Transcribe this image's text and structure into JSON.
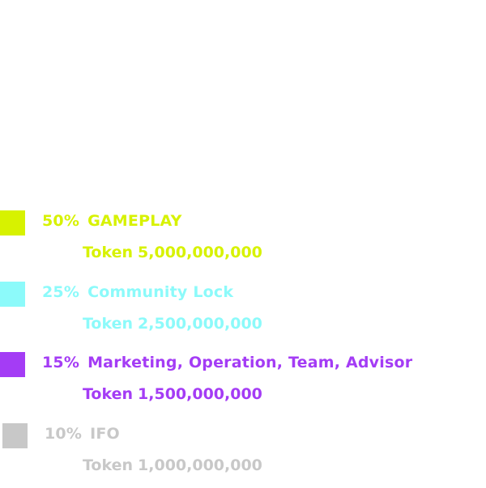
{
  "chart_data": {
    "type": "pie",
    "title": "",
    "categories": [
      "GAMEPLAY",
      "Community Lock",
      "Marketing, Operation, Team, Advisor",
      "IFO"
    ],
    "values": [
      50,
      25,
      15,
      10
    ],
    "unit": "%",
    "legend_position": "bottom-left",
    "slices": [
      {
        "percent_label": "50%",
        "name": "GAMEPLAY",
        "token_label": "Token",
        "token_amount": "5,000,000,000",
        "color": "#D7F200"
      },
      {
        "percent_label": "25%",
        "name": "Community Lock",
        "token_label": "Token",
        "token_amount": "2,500,000,000",
        "color": "#8CFAFA"
      },
      {
        "percent_label": "15%",
        "name": "Marketing, Operation, Team, Advisor",
        "token_label": "Token",
        "token_amount": "1,500,000,000",
        "color": "#A43CF5"
      },
      {
        "percent_label": "10%",
        "name": "IFO",
        "token_label": "Token",
        "token_amount": "1,000,000,000",
        "color": "#C8C8C8"
      }
    ]
  }
}
